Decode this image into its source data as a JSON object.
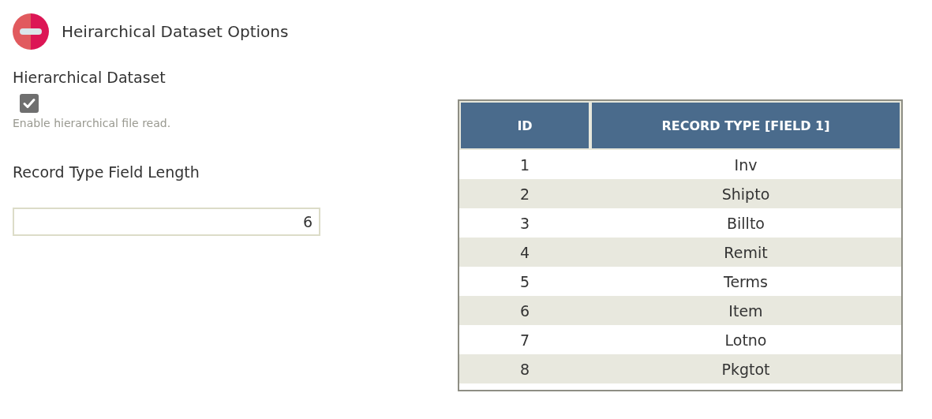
{
  "header": {
    "title": "Heirarchical Dataset Options"
  },
  "hierarchical_dataset": {
    "label": "Hierarchical Dataset",
    "checked": true,
    "hint": "Enable hierarchical file read."
  },
  "record_type_field_length": {
    "label": "Record Type Field Length",
    "value": "6"
  },
  "table": {
    "columns": [
      "ID",
      "RECORD TYPE [FIELD 1]"
    ],
    "rows": [
      [
        "1",
        "Inv"
      ],
      [
        "2",
        "Shipto"
      ],
      [
        "3",
        "Billto"
      ],
      [
        "4",
        "Remit"
      ],
      [
        "5",
        "Terms"
      ],
      [
        "6",
        "Item"
      ],
      [
        "7",
        "Lotno"
      ],
      [
        "8",
        "Pkgtot"
      ]
    ]
  }
}
